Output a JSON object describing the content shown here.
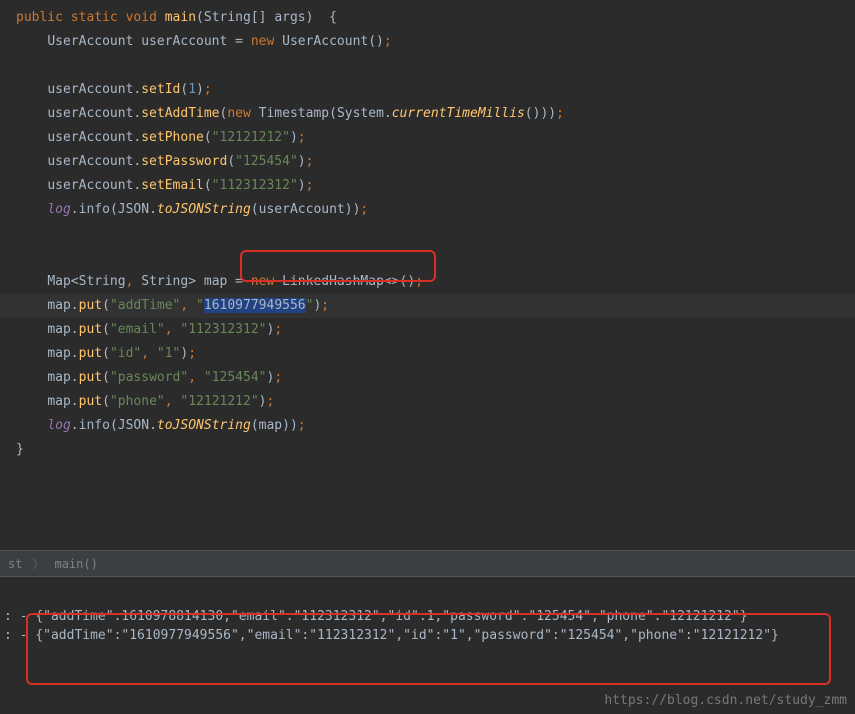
{
  "code": {
    "l1": {
      "kw1": "public",
      "kw2": "static",
      "kw3": "void",
      "method": "main",
      "type": "String",
      "param": "args"
    },
    "l3": {
      "type": "UserAccount",
      "var": "userAccount",
      "kw": "new",
      "ctor": "UserAccount"
    },
    "l5": {
      "var": "userAccount.",
      "method": "setId",
      "num": "1"
    },
    "l6": {
      "var": "userAccount.",
      "method": "setAddTime",
      "kw": "new",
      "type": "Timestamp",
      "cls": "System.",
      "sm": "currentTimeMillis"
    },
    "l7": {
      "var": "userAccount.",
      "method": "setPhone",
      "str": "\"12121212\""
    },
    "l8": {
      "var": "userAccount.",
      "method": "setPassword",
      "str": "\"125454\""
    },
    "l9": {
      "var": "userAccount.",
      "method": "setEmail",
      "str": "\"112312312\""
    },
    "l10": {
      "sf": "log",
      "m": ".info",
      "cls": "JSON.",
      "sm": "toJSONString",
      "var": "userAccount"
    },
    "l13": {
      "type1": "Map",
      "type2": "String",
      "type3": "String",
      "var": "map",
      "kw": "new",
      "ctor": "LinkedHashMap"
    },
    "l14": {
      "var": "map.",
      "method": "put",
      "s1": "\"addTime\"",
      "s2a": "\"",
      "s2b": "1610977949556",
      "s2c": "\""
    },
    "l15": {
      "var": "map.",
      "method": "put",
      "s1": "\"email\"",
      "s2": "\"112312312\""
    },
    "l16": {
      "var": "map.",
      "method": "put",
      "s1": "\"id\"",
      "s2": "\"1\""
    },
    "l17": {
      "var": "map.",
      "method": "put",
      "s1": "\"password\"",
      "s2": "\"125454\""
    },
    "l18": {
      "var": "map.",
      "method": "put",
      "s1": "\"phone\"",
      "s2": "\"12121212\""
    },
    "l19": {
      "sf": "log",
      "m": ".info",
      "cls": "JSON.",
      "sm": "toJSONString",
      "var": "map"
    }
  },
  "breadcrumb": {
    "item1": "st",
    "item2": "main()"
  },
  "console": {
    "prefix": ": - ",
    "line1": "{\"addTime\":1610978814130,\"email\":\"112312312\",\"id\":1,\"password\":\"125454\",\"phone\":\"12121212\"}",
    "line2": "{\"addTime\":\"1610977949556\",\"email\":\"112312312\",\"id\":\"1\",\"password\":\"125454\",\"phone\":\"12121212\"}"
  },
  "watermark": "https://blog.csdn.net/study_zmm"
}
